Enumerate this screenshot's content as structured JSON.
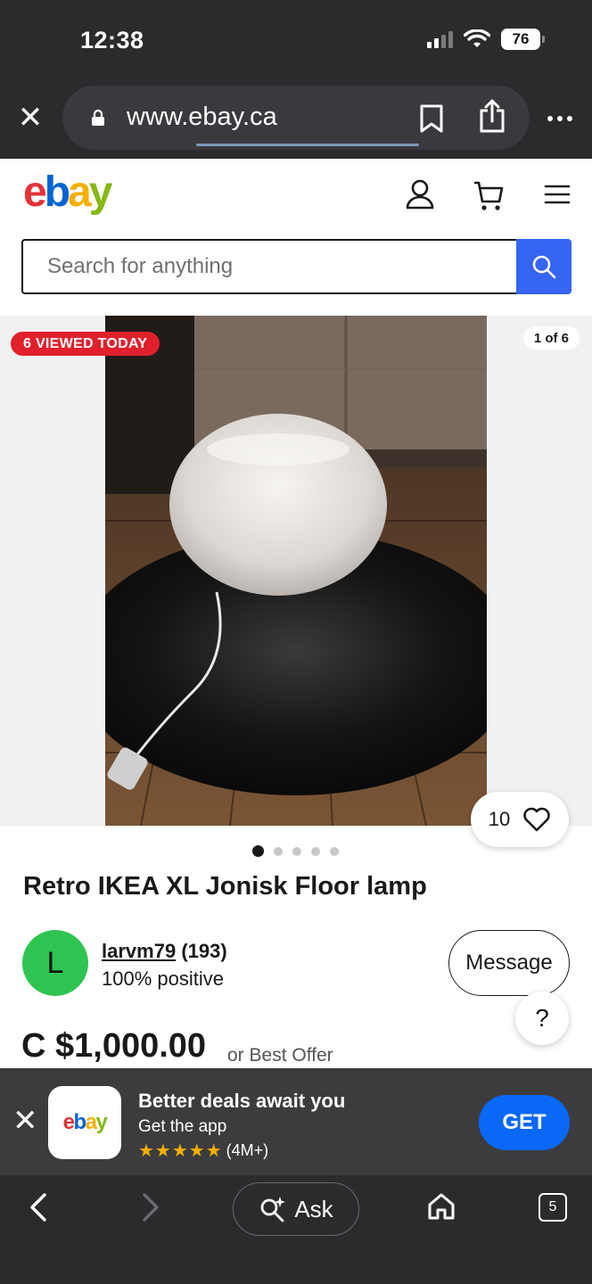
{
  "status_bar": {
    "time": "12:38",
    "battery": "76"
  },
  "browser": {
    "url": "www.ebay.ca"
  },
  "header": {
    "search_placeholder": "Search for anything"
  },
  "gallery": {
    "viewed_badge": "6 VIEWED TODAY",
    "image_counter": "1 of 6",
    "watchers": "10",
    "total_images": 5,
    "active_index": 0
  },
  "listing": {
    "title": "Retro IKEA XL Jonisk Floor lamp",
    "seller_initial": "L",
    "seller_name": "larvm79",
    "seller_feedback": "(193)",
    "seller_positive": "100% positive",
    "message_label": "Message",
    "help_label": "?",
    "price": "C $1,000.00",
    "offer_text": "or Best Offer"
  },
  "app_banner": {
    "title": "Better deals await you",
    "subtitle": "Get the app",
    "stars": "★★★★★",
    "rating_count": "(4M+)",
    "get_label": "GET"
  },
  "toolbar": {
    "ask_label": "Ask",
    "tabs_count": "5"
  },
  "colors": {
    "accent_blue": "#3665f3",
    "badge_red": "#e0212c",
    "avatar_green": "#2fc452",
    "get_blue": "#0968f6"
  }
}
